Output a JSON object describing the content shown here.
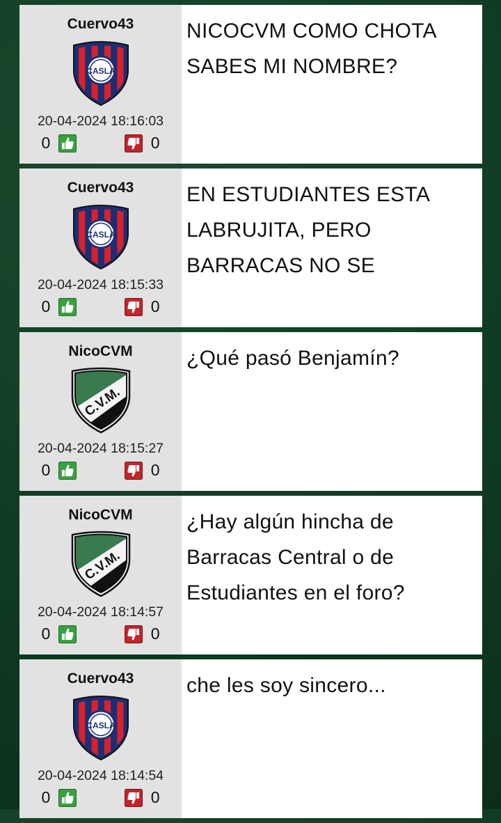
{
  "posts": [
    {
      "user": "Cuervo43",
      "club": "san-lorenzo",
      "crest_text": "CASLA",
      "timestamp": "20-04-2024 18:16:03",
      "likes": "0",
      "dislikes": "0",
      "message": "NICOCVM COMO CHOTA SABES MI NOMBRE?"
    },
    {
      "user": "Cuervo43",
      "club": "san-lorenzo",
      "crest_text": "CASLA",
      "timestamp": "20-04-2024 18:15:33",
      "likes": "0",
      "dislikes": "0",
      "message": "EN ESTUDIANTES ESTA LABRUJITA, PERO BARRACAS NO SE"
    },
    {
      "user": "NicoCVM",
      "club": "cvm",
      "crest_text": "C.V.M.",
      "timestamp": "20-04-2024 18:15:27",
      "likes": "0",
      "dislikes": "0",
      "message": "¿Qué pasó Benjamín?"
    },
    {
      "user": "NicoCVM",
      "club": "cvm",
      "crest_text": "C.V.M.",
      "timestamp": "20-04-2024 18:14:57",
      "likes": "0",
      "dislikes": "0",
      "message": "¿Hay algún hincha de Barracas Central o de Estudiantes en el foro?"
    },
    {
      "user": "Cuervo43",
      "club": "san-lorenzo",
      "crest_text": "CASLA",
      "timestamp": "20-04-2024 18:14:54",
      "likes": "0",
      "dislikes": "0",
      "message": "che les soy sincero..."
    }
  ],
  "colors": {
    "background": "#0f3a22",
    "author_panel": "#e2e2e2",
    "like_green": "#3aa040",
    "dislike_red": "#c0262c",
    "san_lorenzo_red": "#d8222b",
    "san_lorenzo_blue": "#1d2e74",
    "cvm_green": "#3a7a4f"
  },
  "icons": {
    "like": "thumbs-up-icon",
    "dislike": "thumbs-down-icon"
  }
}
